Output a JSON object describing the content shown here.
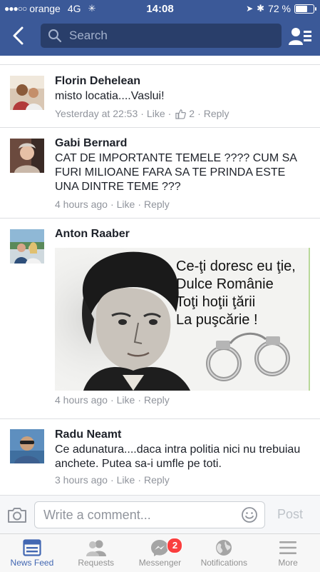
{
  "status": {
    "carrier": "orange",
    "network": "4G",
    "time": "14:08",
    "battery": "72 %",
    "battery_level": 0.72
  },
  "nav": {
    "search_placeholder": "Search"
  },
  "comments": [
    {
      "name": "Florin Dehelean",
      "text": "misto locatia....Vaslui!",
      "time": "Yesterday at 22:53",
      "like": "Like",
      "likes_count": "2",
      "reply": "Reply"
    },
    {
      "name": "Gabi Bernard",
      "text": "CAT DE IMPORTANTE TEMELE ????  CUM SA FURI MILIOANE FARA SA TE PRINDA ESTE UNA DINTRE TEME ???",
      "time": "4 hours ago",
      "like": "Like",
      "reply": "Reply"
    },
    {
      "name": "Anton Raaber",
      "image_lines": [
        "Ce-ţi doresc eu ţie,",
        "Dulce Românie",
        "Toţi hoţii ţării",
        "La puşcărie !"
      ],
      "time": "4 hours ago",
      "like": "Like",
      "reply": "Reply"
    },
    {
      "name": "Radu Neamt",
      "text": "Ce adunatura....daca intra politia nici nu trebuiau anchete. Putea sa-i umfle pe toti.",
      "time": "3 hours ago",
      "like": "Like",
      "reply": "Reply"
    }
  ],
  "composer": {
    "placeholder": "Write a comment...",
    "post_label": "Post"
  },
  "tabs": [
    {
      "label": "News Feed",
      "icon": "news-feed-icon",
      "active": true
    },
    {
      "label": "Requests",
      "icon": "friend-requests-icon"
    },
    {
      "label": "Messenger",
      "icon": "messenger-icon",
      "badge": "2"
    },
    {
      "label": "Notifications",
      "icon": "globe-icon"
    },
    {
      "label": "More",
      "icon": "menu-icon"
    }
  ],
  "colors": {
    "brand": "#3b5998",
    "active_tab": "#4267b2",
    "badge": "#fa3e3e",
    "meta_text": "#90949c"
  }
}
